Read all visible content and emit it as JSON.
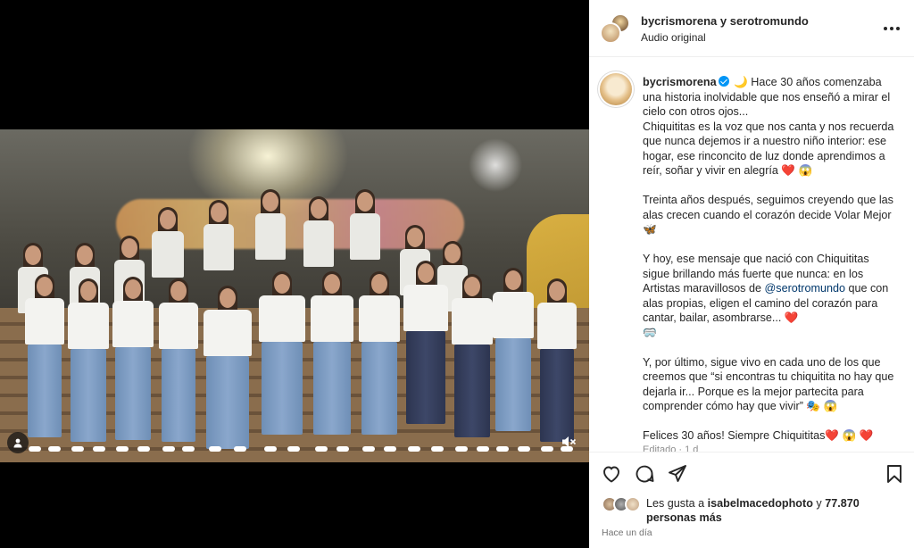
{
  "header": {
    "user": "bycrismorena",
    "conjunction": "y",
    "collaborator": "serotromundo",
    "audio": "Audio original"
  },
  "caption": {
    "username": "bycrismorena",
    "line1": "🌙 Hace 30 años comenzaba una historia inolvidable que nos enseñó a mirar el cielo con otros ojos...",
    "line2": "Chiquititas es la voz que nos canta y nos recuerda que nunca dejemos ir a nuestro niño interior: ese hogar, ese rinconcito de luz donde aprendimos a reír, soñar y vivir en alegría ❤️ 😱",
    "line3": "Treinta años después, seguimos creyendo que las alas crecen cuando el corazón decide Volar Mejor 🦋",
    "line4a": "Y hoy, ese mensaje que nació con Chiquititas sigue brillando más fuerte que nunca: en los Artistas maravillosos de ",
    "mention": "@serotromundo",
    "line4b": " que con alas propias, eligen el camino del corazón para cantar, bailar, asombrarse... ❤️",
    "line4c": "🥽",
    "line5": "Y, por último, sigue vivo en cada uno de los que creemos que “si encontras tu chiquitita no hay que dejarla ir... Porque es la mejor partecita para comprender cómo hay que vivir” 🎭 😱",
    "line6": "Felices 30 años! Siempre Chiquititas❤️ 😱 ❤️",
    "edited": "Editado · 1 d"
  },
  "likes": {
    "prefix": "Les gusta a ",
    "user": "isabelmacedophoto",
    "middle": " y ",
    "count": "77.870 personas más"
  },
  "time": "Hace un día",
  "icons": {
    "like": "heart-icon",
    "comment": "comment-icon",
    "share": "send-icon",
    "save": "bookmark-icon",
    "more": "more-icon",
    "user_tag": "user-tag-icon",
    "mute": "muted-speaker-icon"
  },
  "colors": {
    "verified": "#0095f6",
    "mention": "#00376b",
    "heart": "#e0245e"
  }
}
